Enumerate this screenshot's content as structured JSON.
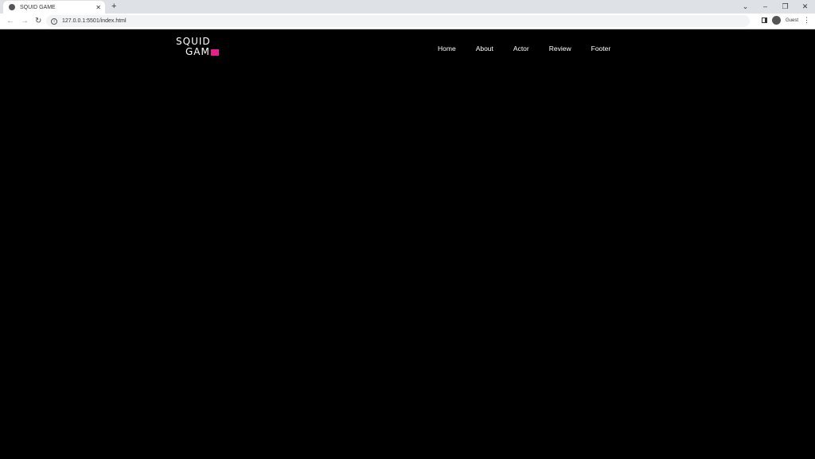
{
  "browser": {
    "tab_title": "SQUID GAME",
    "url": "127.0.0.1:5501/index.html",
    "profile": "Guest"
  },
  "logo": {
    "line1": "SQUID",
    "line2": "GAM",
    "accent": "#e91e8c"
  },
  "nav": [
    {
      "label": "Home"
    },
    {
      "label": "About"
    },
    {
      "label": "Actor"
    },
    {
      "label": "Review"
    },
    {
      "label": "Footer"
    }
  ]
}
